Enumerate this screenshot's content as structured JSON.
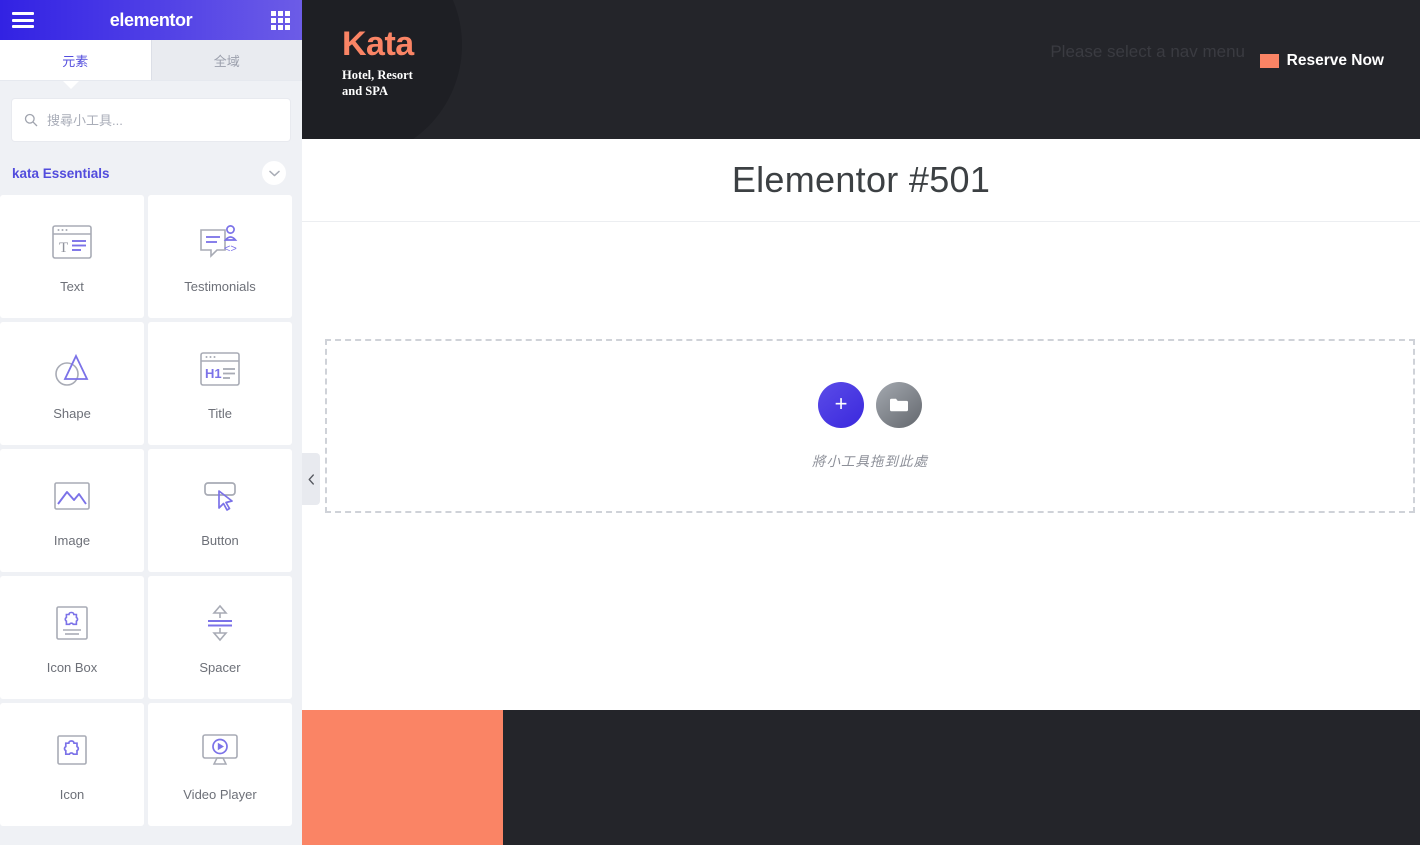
{
  "panel": {
    "header": {
      "brand": "elementor",
      "menu_icon": "hamburger-icon",
      "apps_icon": "grid-apps-icon"
    },
    "tabs": [
      {
        "label": "元素",
        "active": true
      },
      {
        "label": "全域",
        "active": false
      }
    ],
    "search": {
      "placeholder": "搜尋小工具...",
      "value": "",
      "icon": "search-icon"
    },
    "category": {
      "title": "kata Essentials",
      "toggle_icon": "chevron-down-icon"
    },
    "widgets": [
      {
        "label": "Text",
        "icon": "text-widget-icon"
      },
      {
        "label": "Testimonials",
        "icon": "testimonials-widget-icon"
      },
      {
        "label": "Shape",
        "icon": "shape-widget-icon"
      },
      {
        "label": "Title",
        "icon": "title-widget-icon"
      },
      {
        "label": "Image",
        "icon": "image-widget-icon"
      },
      {
        "label": "Button",
        "icon": "button-widget-icon"
      },
      {
        "label": "Icon Box",
        "icon": "icon-box-widget-icon"
      },
      {
        "label": "Spacer",
        "icon": "spacer-widget-icon"
      },
      {
        "label": "Icon",
        "icon": "icon-widget-icon"
      },
      {
        "label": "Video Player",
        "icon": "video-player-widget-icon"
      }
    ],
    "collapse": {
      "icon": "chevron-left-icon"
    }
  },
  "preview": {
    "site_header": {
      "logo_title": "Kata",
      "logo_subtitle": "Hotel, Resort\nand SPA",
      "nav_notice": "Please select a nav menu",
      "reserve_label": "Reserve Now"
    },
    "page_title": "Elementor #501",
    "dropzone": {
      "hint": "將小工具拖到此處",
      "add_icon": "plus-icon",
      "template_icon": "folder-icon"
    }
  },
  "colors": {
    "brand_purple": "#524cdd",
    "header_gradient_start": "#3222e3",
    "header_gradient_end": "#6c5ce7",
    "accent_salmon": "#fa8465",
    "dark_bg": "#24252a",
    "panel_bg": "#eff1f5"
  }
}
